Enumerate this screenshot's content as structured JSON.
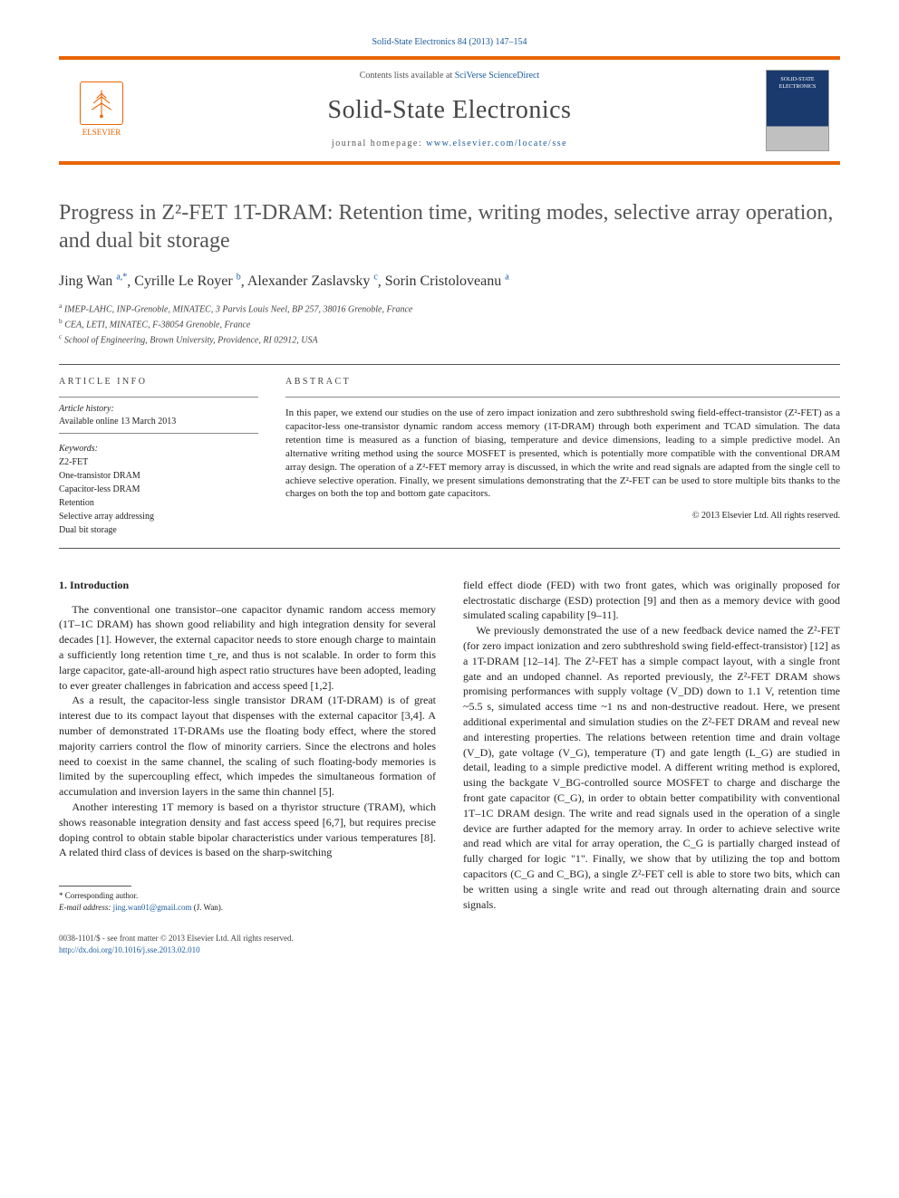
{
  "citation": "Solid-State Electronics 84 (2013) 147–154",
  "masthead": {
    "contents_lists_prefix": "Contents lists available at ",
    "contents_lists_link": "SciVerse ScienceDirect",
    "journal_name": "Solid-State Electronics",
    "homepage_prefix": "journal homepage: ",
    "homepage_link": "www.elsevier.com/locate/sse",
    "publisher": "ELSEVIER",
    "cover_label": "SOLID-STATE ELECTRONICS"
  },
  "title": "Progress in Z²-FET 1T-DRAM: Retention time, writing modes, selective array operation, and dual bit storage",
  "authors": [
    {
      "name": "Jing Wan",
      "marks": "a,*"
    },
    {
      "name": "Cyrille Le Royer",
      "marks": "b"
    },
    {
      "name": "Alexander Zaslavsky",
      "marks": "c"
    },
    {
      "name": "Sorin Cristoloveanu",
      "marks": "a"
    }
  ],
  "affiliations": [
    {
      "mark": "a",
      "text": "IMEP-LAHC, INP-Grenoble, MINATEC, 3 Parvis Louis Neel, BP 257, 38016 Grenoble, France"
    },
    {
      "mark": "b",
      "text": "CEA, LETI, MINATEC, F-38054 Grenoble, France"
    },
    {
      "mark": "c",
      "text": "School of Engineering, Brown University, Providence, RI 02912, USA"
    }
  ],
  "article_info": {
    "heading": "article info",
    "history_label": "Article history:",
    "history_text": "Available online 13 March 2013",
    "keywords_label": "Keywords:",
    "keywords": [
      "Z2-FET",
      "One-transistor DRAM",
      "Capacitor-less DRAM",
      "Retention",
      "Selective array addressing",
      "Dual bit storage"
    ]
  },
  "abstract": {
    "heading": "abstract",
    "text": "In this paper, we extend our studies on the use of zero impact ionization and zero subthreshold swing field-effect-transistor (Z²-FET) as a capacitor-less one-transistor dynamic random access memory (1T-DRAM) through both experiment and TCAD simulation. The data retention time is measured as a function of biasing, temperature and device dimensions, leading to a simple predictive model. An alternative writing method using the source MOSFET is presented, which is potentially more compatible with the conventional DRAM array design. The operation of a Z²-FET memory array is discussed, in which the write and read signals are adapted from the single cell to achieve selective operation. Finally, we present simulations demonstrating that the Z²-FET can be used to store multiple bits thanks to the charges on both the top and bottom gate capacitors.",
    "copyright": "© 2013 Elsevier Ltd. All rights reserved."
  },
  "section1_heading": "1. Introduction",
  "col1": {
    "p1": "The conventional one transistor–one capacitor dynamic random access memory (1T–1C DRAM) has shown good reliability and high integration density for several decades [1]. However, the external capacitor needs to store enough charge to maintain a sufficiently long retention time t_re, and thus is not scalable. In order to form this large capacitor, gate-all-around high aspect ratio structures have been adopted, leading to ever greater challenges in fabrication and access speed [1,2].",
    "p2": "As a result, the capacitor-less single transistor DRAM (1T-DRAM) is of great interest due to its compact layout that dispenses with the external capacitor [3,4]. A number of demonstrated 1T-DRAMs use the floating body effect, where the stored majority carriers control the flow of minority carriers. Since the electrons and holes need to coexist in the same channel, the scaling of such floating-body memories is limited by the supercoupling effect, which impedes the simultaneous formation of accumulation and inversion layers in the same thin channel [5].",
    "p3": "Another interesting 1T memory is based on a thyristor structure (TRAM), which shows reasonable integration density and fast access speed [6,7], but requires precise doping control to obtain stable bipolar characteristics under various temperatures [8]. A related third class of devices is based on the sharp-switching"
  },
  "col2": {
    "p1": "field effect diode (FED) with two front gates, which was originally proposed for electrostatic discharge (ESD) protection [9] and then as a memory device with good simulated scaling capability [9–11].",
    "p2": "We previously demonstrated the use of a new feedback device named the Z²-FET (for zero impact ionization and zero subthreshold swing field-effect-transistor) [12] as a 1T-DRAM [12–14]. The Z²-FET has a simple compact layout, with a single front gate and an undoped channel. As reported previously, the Z²-FET DRAM shows promising performances with supply voltage (V_DD) down to 1.1 V, retention time ~5.5 s, simulated access time ~1 ns and non-destructive readout. Here, we present additional experimental and simulation studies on the Z²-FET DRAM and reveal new and interesting properties. The relations between retention time and drain voltage (V_D), gate voltage (V_G), temperature (T) and gate length (L_G) are studied in detail, leading to a simple predictive model. A different writing method is explored, using the backgate V_BG-controlled source MOSFET to charge and discharge the front gate capacitor (C_G), in order to obtain better compatibility with conventional 1T–1C DRAM design. The write and read signals used in the operation of a single device are further adapted for the memory array. In order to achieve selective write and read which are vital for array operation, the C_G is partially charged instead of fully charged for logic \"1\". Finally, we show that by utilizing the top and bottom capacitors (C_G and C_BG), a single Z²-FET cell is able to store two bits, which can be written using a single write and read out through alternating drain and source signals."
  },
  "footnotes": {
    "corresponding": "* Corresponding author.",
    "email_label": "E-mail address: ",
    "email": "jing.wan01@gmail.com",
    "email_who": " (J. Wan)."
  },
  "bottom": {
    "issn": "0038-1101/$ - see front matter © 2013 Elsevier Ltd. All rights reserved.",
    "doi_link": "http://dx.doi.org/10.1016/j.sse.2013.02.010"
  }
}
